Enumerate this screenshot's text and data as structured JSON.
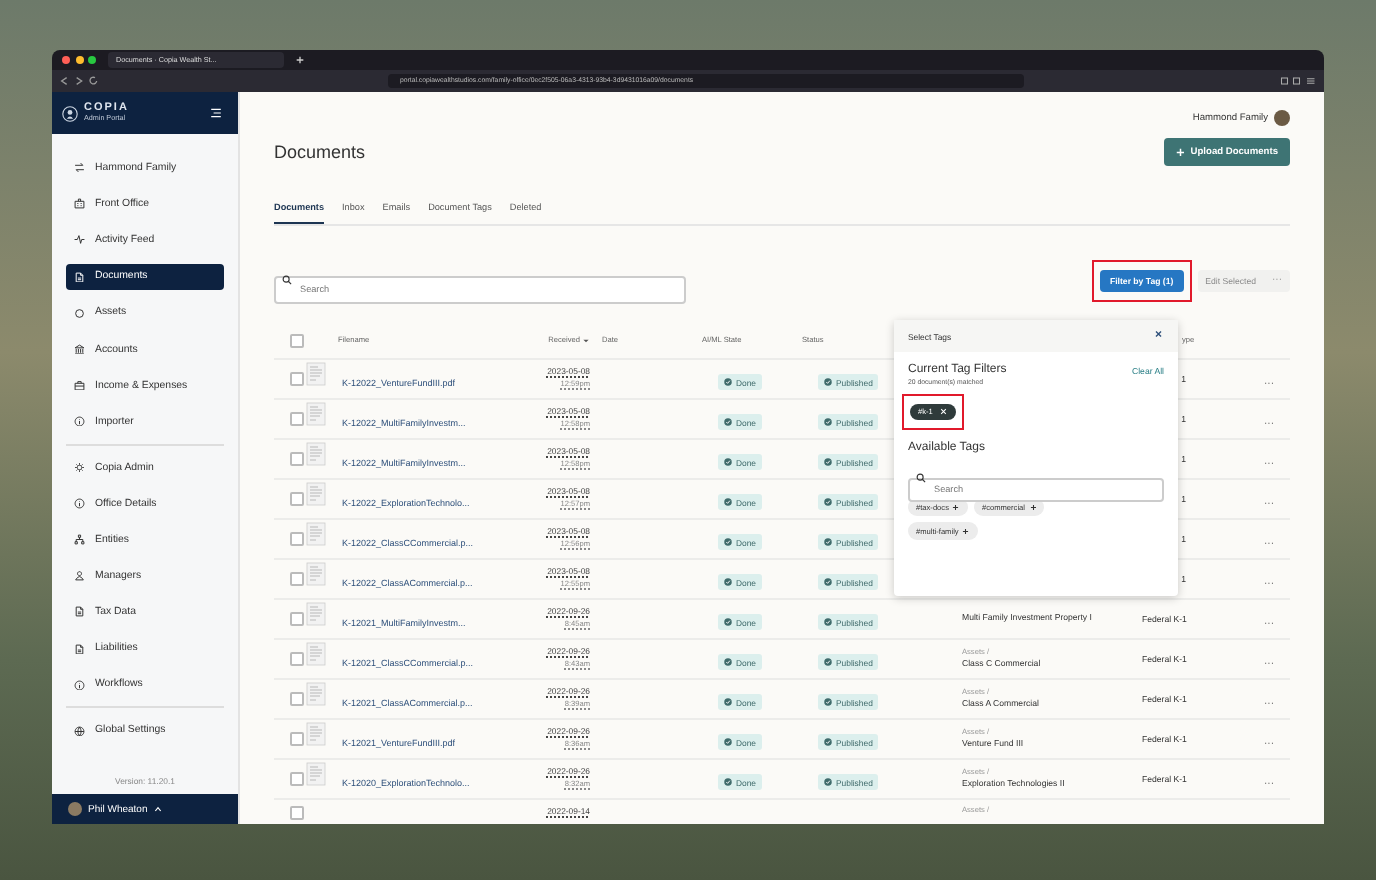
{
  "browser": {
    "tab_title": "Documents · Copia Wealth St...",
    "url": "portal.copiawealthstudios.com/family-office/0ec2f505-06a3-4313-93b4-3d9431016a09/documents"
  },
  "sidebar": {
    "logo": "COPIA",
    "subtitle": "Admin Portal",
    "sections": [
      {
        "items": [
          {
            "label": "Hammond Family",
            "selected": false
          },
          {
            "label": "Front Office",
            "selected": false
          },
          {
            "label": "Activity Feed",
            "selected": false
          },
          {
            "label": "Documents",
            "selected": true
          },
          {
            "label": "Assets",
            "selected": false
          },
          {
            "label": "Accounts",
            "selected": false
          },
          {
            "label": "Income & Expenses",
            "selected": false
          },
          {
            "label": "Importer",
            "selected": false
          }
        ]
      },
      {
        "items": [
          {
            "label": "Copia Admin",
            "selected": false
          },
          {
            "label": "Office Details",
            "selected": false
          },
          {
            "label": "Entities",
            "selected": false
          },
          {
            "label": "Managers",
            "selected": false
          },
          {
            "label": "Tax Data",
            "selected": false
          },
          {
            "label": "Liabilities",
            "selected": false
          },
          {
            "label": "Workflows",
            "selected": false
          }
        ]
      },
      {
        "items": [
          {
            "label": "Global Settings",
            "selected": false
          }
        ]
      }
    ],
    "version": "Version: 11.20.1",
    "user": "Phil Wheaton"
  },
  "main": {
    "account": "Hammond Family",
    "title": "Documents",
    "upload_button": "Upload Documents",
    "tabs": [
      {
        "label": "Documents",
        "selected": true
      },
      {
        "label": "Inbox",
        "selected": false
      },
      {
        "label": "Emails",
        "selected": false
      },
      {
        "label": "Document Tags",
        "selected": false
      },
      {
        "label": "Deleted",
        "selected": false
      }
    ],
    "search": {
      "placeholder": "Search"
    },
    "filter_button": {
      "label": "Filter by Tag (1)",
      "highlighted": true
    },
    "edit_button": {
      "label": "Edit Selected",
      "disabled": true,
      "menu": "···"
    },
    "table": {
      "select_all_checked": false,
      "columns": [
        {
          "label": "Filename",
          "sorted": false
        },
        {
          "label": "Received",
          "sorted": true
        },
        {
          "label": "Date",
          "sorted": false
        },
        {
          "label": "AI/ML State",
          "sorted": false
        },
        {
          "label": "Status",
          "sorted": false
        },
        {
          "label": "ype"
        }
      ],
      "rows": [
        {
          "checked": false,
          "filename": "K-12022_VentureFundIII.pdf",
          "received_date": "2023-05-08",
          "received_time": "12:59pm",
          "ai_state": "Done",
          "status": "Published",
          "type": "1",
          "menu": "···"
        },
        {
          "checked": false,
          "filename": "K-12022_MultiFamilyInvestm...",
          "received_date": "2023-05-08",
          "received_time": "12:58pm",
          "ai_state": "Done",
          "status": "Published",
          "type": "1",
          "menu": "···"
        },
        {
          "checked": false,
          "filename": "K-12022_MultiFamilyInvestm...",
          "received_date": "2023-05-08",
          "received_time": "12:58pm",
          "ai_state": "Done",
          "status": "Published",
          "type": "1",
          "menu": "···"
        },
        {
          "checked": false,
          "filename": "K-12022_ExplorationTechnolo...",
          "received_date": "2023-05-08",
          "received_time": "12:57pm",
          "ai_state": "Done",
          "status": "Published",
          "type": "1",
          "menu": "···"
        },
        {
          "checked": false,
          "filename": "K-12022_ClassCCommercial.p...",
          "received_date": "2023-05-08",
          "received_time": "12:56pm",
          "ai_state": "Done",
          "status": "Published",
          "type": "1",
          "menu": "···"
        },
        {
          "checked": false,
          "filename": "K-12022_ClassACommercial.p...",
          "received_date": "2023-05-08",
          "received_time": "12:55pm",
          "ai_state": "Done",
          "status": "Published",
          "type": "1",
          "menu": "···"
        },
        {
          "checked": false,
          "filename": "K-12021_MultiFamilyInvestm...",
          "received_date": "2022-09-26",
          "received_time": "8:45am",
          "ai_state": "Done",
          "status": "Published",
          "location": "Multi Family Investment Property I",
          "type": "Federal K-1",
          "menu": "···"
        },
        {
          "checked": false,
          "filename": "K-12021_ClassCCommercial.p...",
          "received_date": "2022-09-26",
          "received_time": "8:43am",
          "ai_state": "Done",
          "status": "Published",
          "folder": "Assets /",
          "location": "Class C Commercial",
          "type": "Federal K-1",
          "menu": "···"
        },
        {
          "checked": false,
          "filename": "K-12021_ClassACommercial.p...",
          "received_date": "2022-09-26",
          "received_time": "8:39am",
          "ai_state": "Done",
          "status": "Published",
          "folder": "Assets /",
          "location": "Class A Commercial",
          "type": "Federal K-1",
          "menu": "···"
        },
        {
          "checked": false,
          "filename": "K-12021_VentureFundIII.pdf",
          "received_date": "2022-09-26",
          "received_time": "8:36am",
          "ai_state": "Done",
          "status": "Published",
          "folder": "Assets /",
          "location": "Venture Fund III",
          "type": "Federal K-1",
          "menu": "···"
        },
        {
          "checked": false,
          "filename": "K-12020_ExplorationTechnolo...",
          "received_date": "2022-09-26",
          "received_time": "8:32am",
          "ai_state": "Done",
          "status": "Published",
          "folder": "Assets /",
          "location": "Exploration Technologies II",
          "type": "Federal K-1",
          "menu": "···"
        },
        {
          "checked": false,
          "received_date": "2022-09-14",
          "folder": "Assets /"
        }
      ]
    },
    "tag_popup": {
      "title": "Select Tags",
      "close": "×",
      "current_heading": "Current Tag Filters",
      "clear": "Clear All",
      "matched": "20 document(s) matched",
      "active_tags": [
        {
          "label": "#k-1",
          "highlighted": true
        }
      ],
      "available_heading": "Available Tags",
      "search_placeholder": "Search",
      "available_tags": [
        {
          "label": "#tax-docs"
        },
        {
          "label": "#commercial"
        },
        {
          "label": "#multi-family"
        }
      ]
    }
  }
}
